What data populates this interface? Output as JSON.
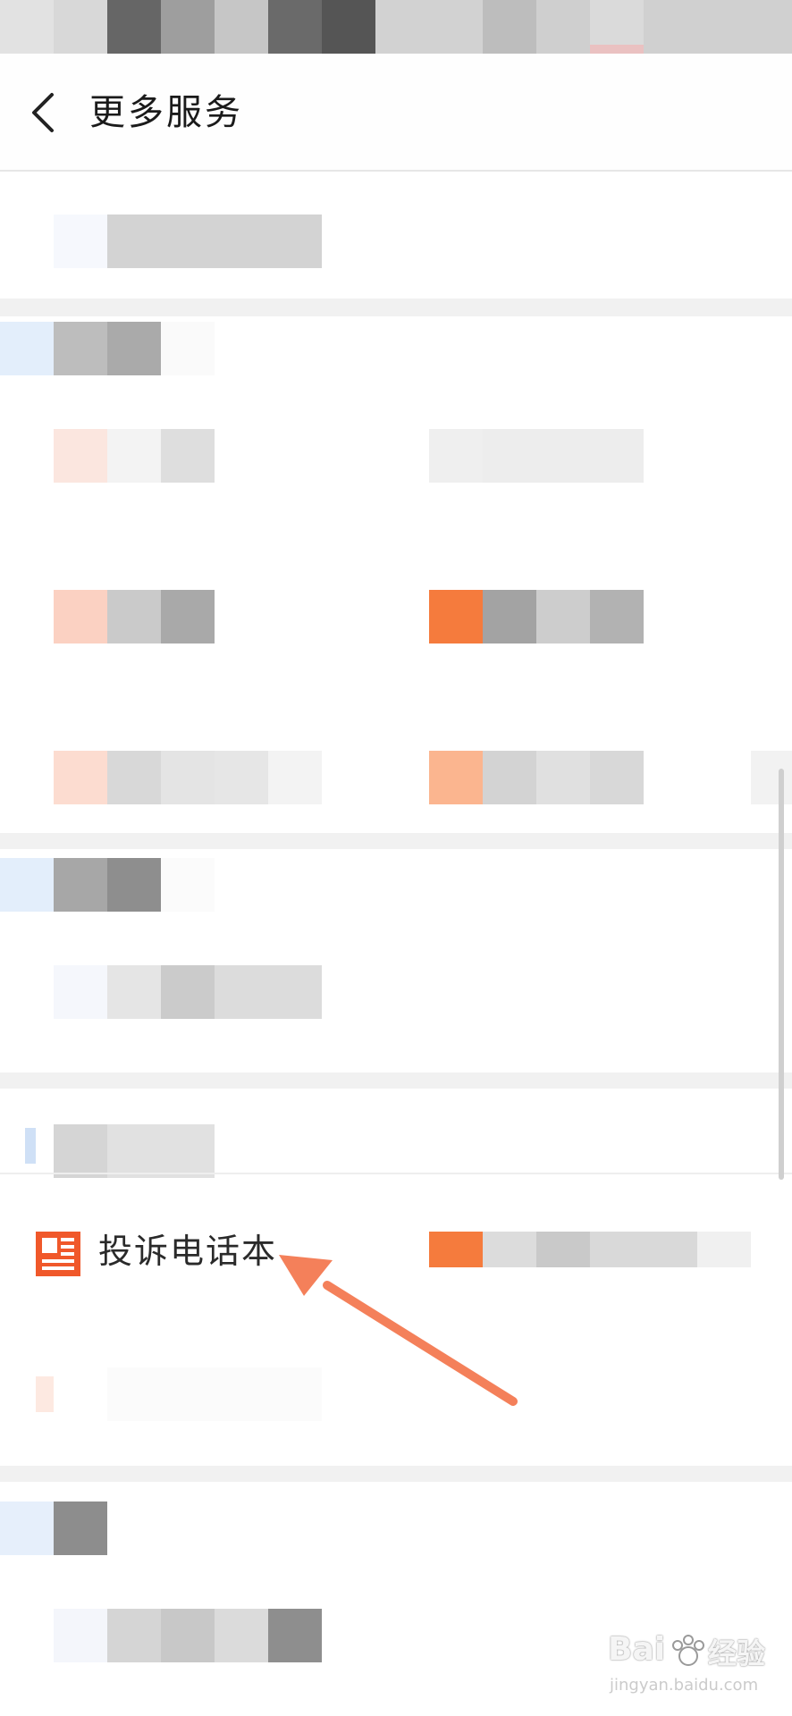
{
  "header": {
    "title": "更多服务"
  },
  "complaint_item": {
    "label": "投诉电话本",
    "icon": "document-icon",
    "icon_color": "#f0582a"
  },
  "annotation": {
    "arrow_color": "#f4805a"
  },
  "watermark": {
    "brand": "Bai",
    "brand_suffix": "经验",
    "url": "jingyan.baidu.com"
  },
  "colors": {
    "accent": "#f0582a",
    "background": "#ffffff",
    "divider": "#f1f1f1"
  }
}
